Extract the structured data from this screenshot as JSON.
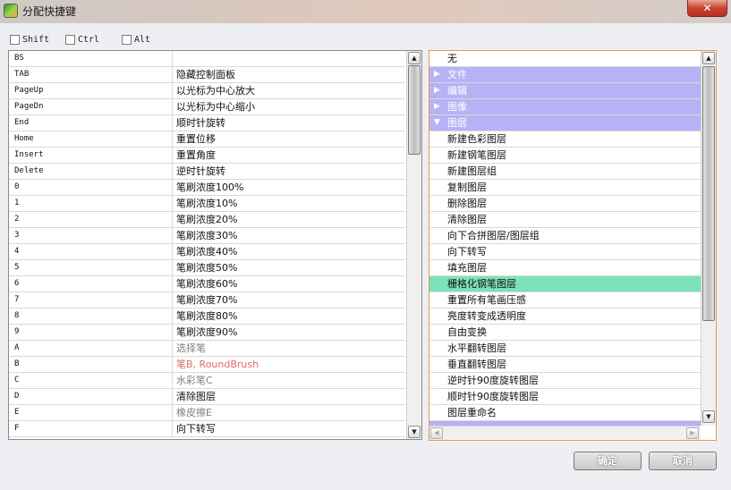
{
  "window": {
    "title": "分配快捷键",
    "close_label": "✕"
  },
  "modifiers": [
    {
      "label": "Shift",
      "checked": false
    },
    {
      "label": "Ctrl",
      "checked": false
    },
    {
      "label": "Alt",
      "checked": false
    }
  ],
  "shortcut_table": {
    "rows": [
      {
        "key": "BS",
        "command": "",
        "style": "normal"
      },
      {
        "key": "TAB",
        "command": "隐藏控制面板",
        "style": "normal"
      },
      {
        "key": "PageUp",
        "command": "以光标为中心放大",
        "style": "normal"
      },
      {
        "key": "PageDn",
        "command": "以光标为中心缩小",
        "style": "normal"
      },
      {
        "key": "End",
        "command": "顺时针旋转",
        "style": "normal"
      },
      {
        "key": "Home",
        "command": "重置位移",
        "style": "normal"
      },
      {
        "key": "Insert",
        "command": "重置角度",
        "style": "normal"
      },
      {
        "key": "Delete",
        "command": "逆时针旋转",
        "style": "normal"
      },
      {
        "key": "0",
        "command": "笔刷浓度100%",
        "style": "normal"
      },
      {
        "key": "1",
        "command": "笔刷浓度10%",
        "style": "normal"
      },
      {
        "key": "2",
        "command": "笔刷浓度20%",
        "style": "normal"
      },
      {
        "key": "3",
        "command": "笔刷浓度30%",
        "style": "normal"
      },
      {
        "key": "4",
        "command": "笔刷浓度40%",
        "style": "normal"
      },
      {
        "key": "5",
        "command": "笔刷浓度50%",
        "style": "normal"
      },
      {
        "key": "6",
        "command": "笔刷浓度60%",
        "style": "normal"
      },
      {
        "key": "7",
        "command": "笔刷浓度70%",
        "style": "normal"
      },
      {
        "key": "8",
        "command": "笔刷浓度80%",
        "style": "normal"
      },
      {
        "key": "9",
        "command": "笔刷浓度90%",
        "style": "normal"
      },
      {
        "key": "A",
        "command": "选择笔",
        "style": "gray"
      },
      {
        "key": "B",
        "command": "笔B, RoundBrush",
        "style": "red"
      },
      {
        "key": "C",
        "command": "水彩笔C",
        "style": "gray"
      },
      {
        "key": "D",
        "command": "清除图层",
        "style": "normal"
      },
      {
        "key": "E",
        "command": "橡皮擦E",
        "style": "gray"
      },
      {
        "key": "F",
        "command": "向下转写",
        "style": "normal"
      }
    ]
  },
  "command_tree": {
    "items": [
      {
        "label": "无",
        "kind": "item"
      },
      {
        "label": "文件",
        "kind": "category",
        "expanded": false
      },
      {
        "label": "编辑",
        "kind": "category",
        "expanded": false
      },
      {
        "label": "图像",
        "kind": "category",
        "expanded": false
      },
      {
        "label": "图层",
        "kind": "category",
        "expanded": true
      },
      {
        "label": "新建色彩图层",
        "kind": "item"
      },
      {
        "label": "新建钢笔图层",
        "kind": "item"
      },
      {
        "label": "新建图层组",
        "kind": "item"
      },
      {
        "label": "复制图层",
        "kind": "item"
      },
      {
        "label": "删除图层",
        "kind": "item"
      },
      {
        "label": "清除图层",
        "kind": "item"
      },
      {
        "label": "向下合拼图层/图层组",
        "kind": "item"
      },
      {
        "label": "向下转写",
        "kind": "item"
      },
      {
        "label": "填充图层",
        "kind": "item"
      },
      {
        "label": "栅格化钢笔图层",
        "kind": "item",
        "selected": true
      },
      {
        "label": "重置所有笔画压感",
        "kind": "item"
      },
      {
        "label": "亮度转变成透明度",
        "kind": "item"
      },
      {
        "label": "自由变换",
        "kind": "item"
      },
      {
        "label": "水平翻转图层",
        "kind": "item"
      },
      {
        "label": "垂直翻转图层",
        "kind": "item"
      },
      {
        "label": "逆时针90度旋转图层",
        "kind": "item"
      },
      {
        "label": "顺时针90度旋转图层",
        "kind": "item"
      },
      {
        "label": "图层重命名",
        "kind": "item"
      },
      {
        "label": "",
        "kind": "category",
        "expanded": false
      }
    ]
  },
  "buttons": {
    "ok_label": "确定",
    "cancel_label": "取消"
  },
  "colors": {
    "category_bg": "#b7b2f6",
    "selected_bg": "#7ce2b7",
    "focus_border": "#e29a55"
  }
}
